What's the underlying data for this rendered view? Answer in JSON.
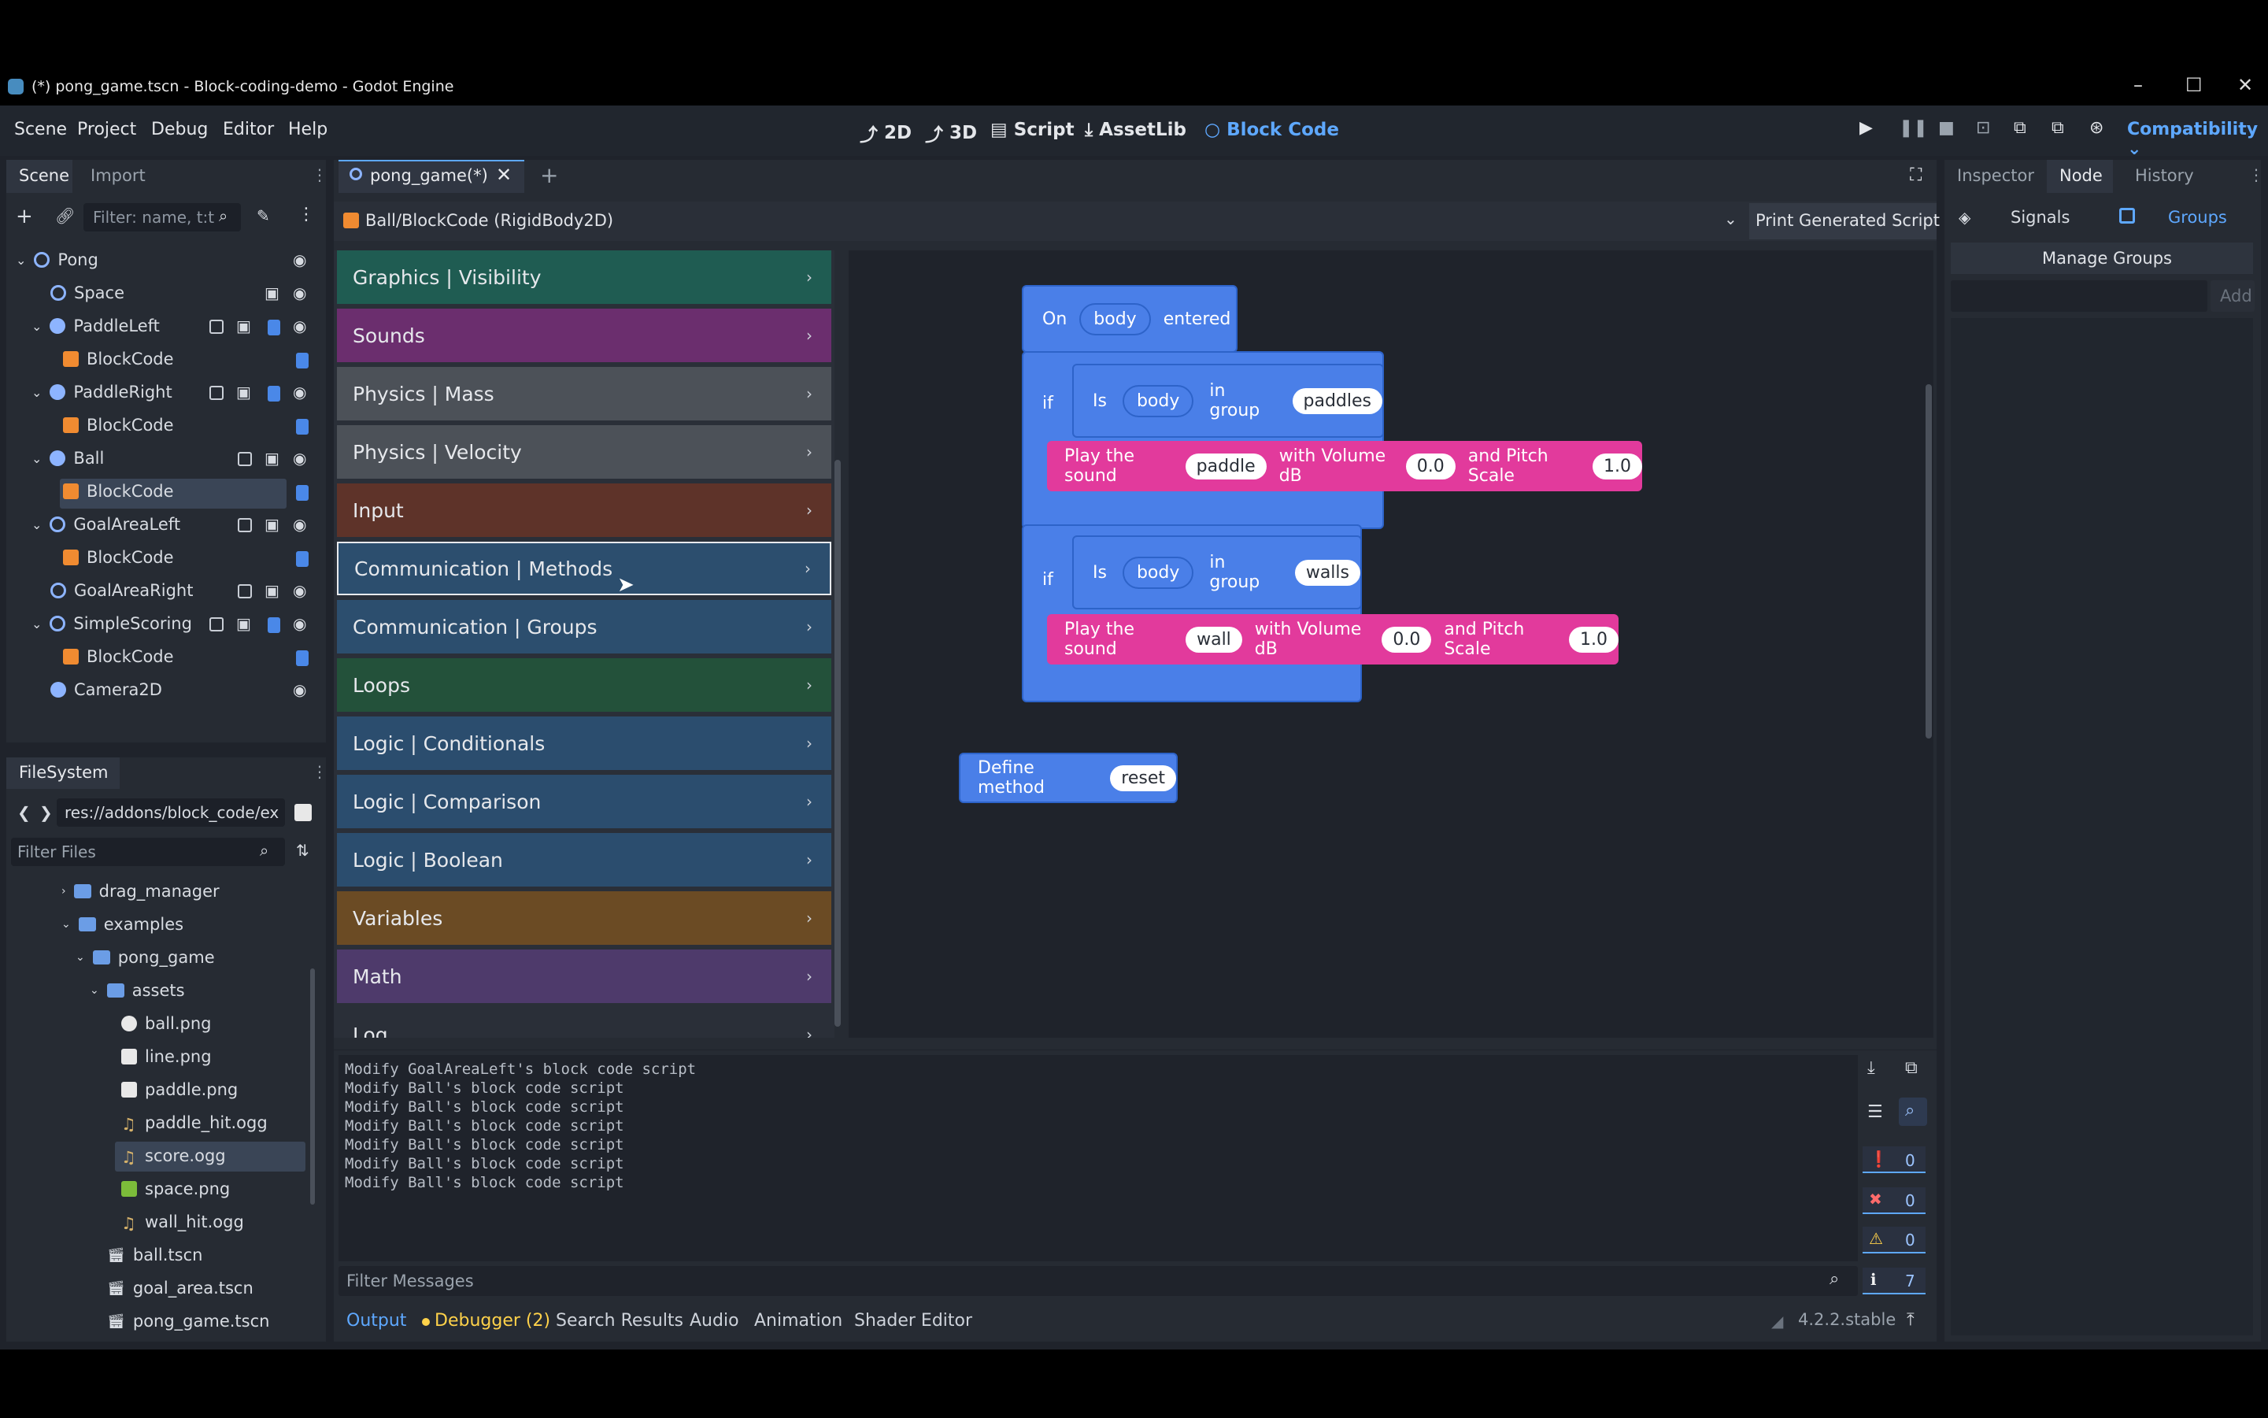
{
  "window": {
    "title": "(*) pong_game.tscn - Block-coding-demo - Godot Engine",
    "controls": [
      "–",
      "☐",
      "✕"
    ]
  },
  "menus": [
    "Scene",
    "Project",
    "Debug",
    "Editor",
    "Help"
  ],
  "modes": [
    {
      "label": "2D"
    },
    {
      "label": "3D"
    },
    {
      "label": "Script"
    },
    {
      "label": "AssetLib"
    },
    {
      "label": "Block Code"
    }
  ],
  "renderer": "Compatibility",
  "scene_dock": {
    "tabs": [
      "Scene",
      "Import"
    ],
    "filter_placeholder": "Filter: name, t:t",
    "tree": [
      {
        "label": "Pong"
      },
      {
        "label": "Space"
      },
      {
        "label": "PaddleLeft"
      },
      {
        "label": "BlockCode"
      },
      {
        "label": "PaddleRight"
      },
      {
        "label": "BlockCode"
      },
      {
        "label": "Ball"
      },
      {
        "label": "BlockCode"
      },
      {
        "label": "GoalAreaLeft"
      },
      {
        "label": "BlockCode"
      },
      {
        "label": "GoalAreaRight"
      },
      {
        "label": "SimpleScoring"
      },
      {
        "label": "BlockCode"
      },
      {
        "label": "Camera2D"
      }
    ]
  },
  "filesystem": {
    "title": "FileSystem",
    "path": "res://addons/block_code/ex",
    "filter_placeholder": "Filter Files",
    "items": [
      {
        "label": "drag_manager"
      },
      {
        "label": "examples"
      },
      {
        "label": "pong_game"
      },
      {
        "label": "assets"
      },
      {
        "label": "ball.png"
      },
      {
        "label": "line.png"
      },
      {
        "label": "paddle.png"
      },
      {
        "label": "paddle_hit.ogg"
      },
      {
        "label": "score.ogg"
      },
      {
        "label": "space.png"
      },
      {
        "label": "wall_hit.ogg"
      },
      {
        "label": "ball.tscn"
      },
      {
        "label": "goal_area.tscn"
      },
      {
        "label": "pong_game.tscn"
      }
    ]
  },
  "editor": {
    "tab": "pong_game(*)",
    "breadcrumb": "Ball/BlockCode (RigidBody2D)",
    "print_button": "Print Generated Script"
  },
  "categories": [
    {
      "label": "Graphics | Visibility",
      "color": "#1f5c52"
    },
    {
      "label": "Sounds",
      "color": "#6b2e6e"
    },
    {
      "label": "Physics | Mass",
      "color": "#4c5158"
    },
    {
      "label": "Physics | Velocity",
      "color": "#4c5158"
    },
    {
      "label": "Input",
      "color": "#5e3329"
    },
    {
      "label": "Communication | Methods",
      "color": "#2c4e6e"
    },
    {
      "label": "Communication | Groups",
      "color": "#2c4e6e"
    },
    {
      "label": "Loops",
      "color": "#23513a"
    },
    {
      "label": "Logic | Conditionals",
      "color": "#2b4d6e"
    },
    {
      "label": "Logic | Comparison",
      "color": "#2b4d6e"
    },
    {
      "label": "Logic | Boolean",
      "color": "#2b4d6e"
    },
    {
      "label": "Variables",
      "color": "#6b4b24"
    },
    {
      "label": "Math",
      "color": "#4e3a6b"
    },
    {
      "label": "Log",
      "color": "#2a2f38"
    }
  ],
  "blocks": {
    "on": "On",
    "body": "body",
    "entered": "entered",
    "if": "if",
    "is": "Is",
    "in_group": "in group",
    "paddles": "paddles",
    "walls": "walls",
    "play_sound": "Play the sound",
    "with_volume": "with Volume dB",
    "and_pitch": "and Pitch Scale",
    "paddle": "paddle",
    "wall": "wall",
    "vol": "0.0",
    "pitch": "1.0",
    "define_method": "Define method",
    "reset": "reset"
  },
  "inspector": {
    "tabs": [
      "Inspector",
      "Node",
      "History"
    ],
    "signals": "Signals",
    "groups": "Groups",
    "manage_groups": "Manage Groups",
    "add": "Add"
  },
  "output": {
    "lines": [
      "Modify GoalAreaLeft's block code script",
      "Modify Ball's block code script",
      "Modify Ball's block code script",
      "Modify Ball's block code script",
      "Modify Ball's block code script",
      "Modify Ball's block code script",
      "Modify Ball's block code script"
    ],
    "filter_placeholder": "Filter Messages",
    "counts": {
      "errors_crit": "0",
      "errors": "0",
      "warnings": "0",
      "info": "7"
    }
  },
  "bottom_tabs": [
    "Output",
    "Debugger (2)",
    "Search Results",
    "Audio",
    "Animation",
    "Shader Editor"
  ],
  "version": "4.2.2.stable"
}
